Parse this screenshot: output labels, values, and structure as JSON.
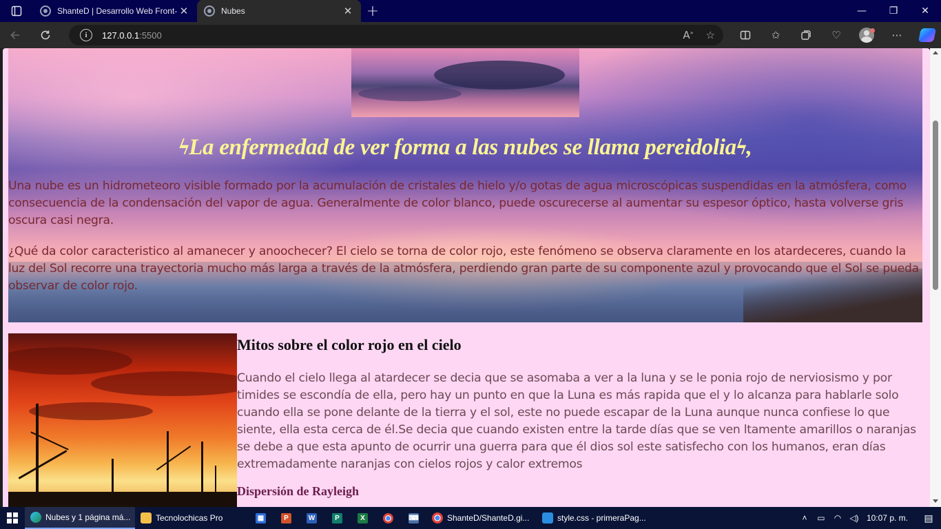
{
  "browser": {
    "tabs": [
      {
        "title": "ShanteD | Desarrollo Web Front-I",
        "close": "✕"
      },
      {
        "title": "Nubes",
        "close": "✕"
      }
    ],
    "new_tab": "+",
    "window_controls": {
      "minimize": "—",
      "maximize": "❐",
      "close": "✕"
    },
    "address": {
      "host": "127.0.0.1",
      "port": ":5500"
    },
    "icons": [
      "tab-actions-icon",
      "back-icon",
      "refresh-icon",
      "site-info-icon",
      "read-aloud-icon",
      "favorite-star-icon",
      "split-screen-icon",
      "favorites-icon",
      "collections-icon",
      "browser-essentials-icon",
      "profile-avatar",
      "more-icon",
      "copilot-icon"
    ]
  },
  "page": {
    "quote": "ϟLa enfermedad de ver forma a las nubes se llama pereidoliaϟ,",
    "paragraph1": "Una nube es un hidrometeoro visible formado por la acumulación de cristales de hielo y/o gotas de agua microscópicas suspendidas en la atmósfera, como consecuencia de la condensación del vapor de agua. Generalmente de color blanco, puede oscurecerse al aumentar su espesor óptico, hasta volverse gris oscura casi negra.",
    "paragraph2": "¿Qué da color caracteristico al amanecer y anoochecer? El cielo se torna de color rojo, este fenómeno se observa claramente en los atardeceres, cuando la luz del Sol recorre una trayectoria mucho más larga a través de la atmósfera, perdiendo gran parte de su componente azul y provocando que el Sol se pueda observar de color rojo.",
    "section_title": "Mitos sobre el color rojo en el cielo",
    "section_body": "Cuando el cielo llega al atardecer se decia que se asomaba a ver a la luna y se le ponia rojo de nerviosismo y por timides se escondía de ella, pero hay un punto en que la Luna es más rapida que el y lo alcanza para hablarle solo cuando ella se pone delante de la tierra y el sol, este no puede escapar de la Luna aunque nunca confiese lo que siente, ella esta cerca de él.Se decia que cuando existen entre la tarde días que se ven ltamente amarillos o naranjas se debe a que esta apunto de ocurrir una guerra para que él dios sol este satisfecho con los humanos, eran días extremadamente naranjas con cielos rojos y calor extremos",
    "subsection_title": "Dispersión de Rayleigh",
    "colors": {
      "background": "#fdd7f3",
      "quote": "#fbf494",
      "hero_text": "#7a2830",
      "body_text": "#6b4a55",
      "subheading": "#6b1e4e"
    }
  },
  "taskbar": {
    "items": [
      {
        "label": "Nubes y 1 página má...",
        "icon": "edge-icon",
        "active": true
      },
      {
        "label": "Tecnolochicas Pro",
        "icon": "folder-icon",
        "active": false
      }
    ],
    "apps": [
      "calculator-icon",
      "powerpoint-icon",
      "word-icon",
      "publisher-icon",
      "excel-icon",
      "chrome-icon",
      "keyboard-icon"
    ],
    "items2": [
      {
        "label": "ShanteD/ShanteD.gi...",
        "icon": "chrome-icon"
      },
      {
        "label": "style.css - primeraPag...",
        "icon": "vscode-icon"
      }
    ],
    "clock": "10:07 p. m."
  }
}
